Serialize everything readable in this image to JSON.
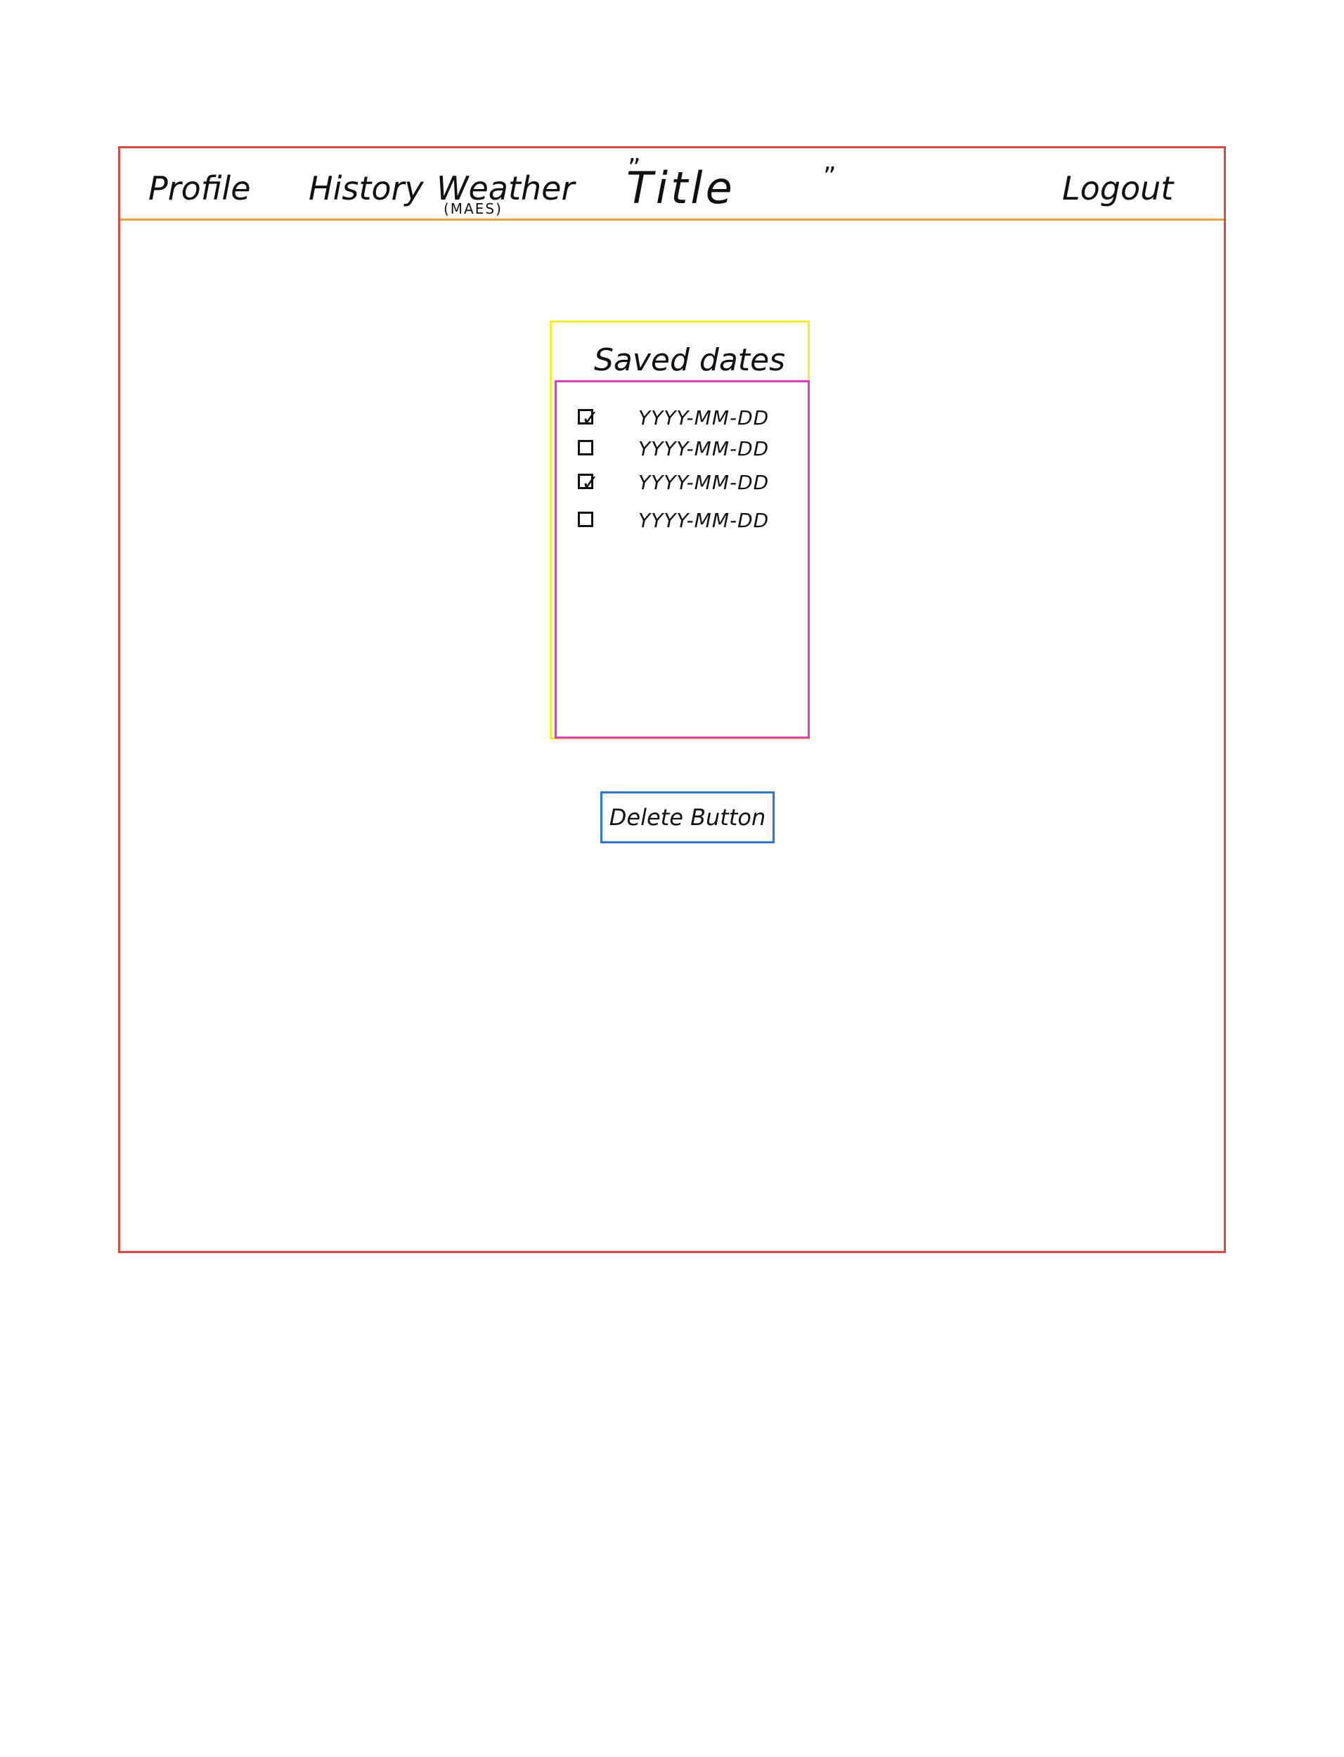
{
  "nav": {
    "profile": "Profile",
    "history": "History",
    "weather": "Weather",
    "weather_sub": "(MAES)",
    "title": "Title",
    "title_quote_open": "”",
    "title_quote_close": "”",
    "logout": "Logout"
  },
  "saved_dates": {
    "heading": "Saved dates",
    "items": [
      {
        "label": "YYYY-MM-DD",
        "checked": true,
        "mark": "✓"
      },
      {
        "label": "YYYY-MM-DD",
        "checked": false,
        "mark": ""
      },
      {
        "label": "YYYY-MM-DD",
        "checked": true,
        "mark": "✓"
      },
      {
        "label": "YYYY-MM-DD",
        "checked": false,
        "mark": ""
      }
    ]
  },
  "actions": {
    "delete_label": "Delete Button"
  },
  "colors": {
    "frame": "#e8463c",
    "navbar_divider": "#f0a23a",
    "saved_panel": "#f7ef2a",
    "saved_list": "#e838c8",
    "delete_button": "#2a79d8"
  }
}
